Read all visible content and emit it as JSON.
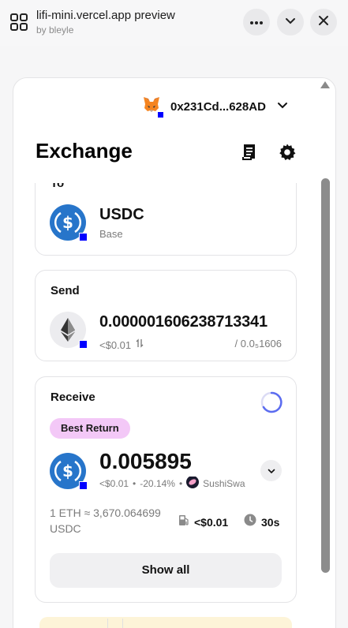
{
  "window": {
    "title": "lifi-mini.vercel.app preview",
    "subtitle": "by bleyle"
  },
  "wallet": {
    "address": "0x231Cd...628AD"
  },
  "exchange": {
    "title": "Exchange"
  },
  "to_card": {
    "label": "To",
    "token_symbol": "USDC",
    "chain_name": "Base"
  },
  "send_card": {
    "label": "Send",
    "amount": "0.000001606238713341",
    "usd_value": "<$0.01",
    "balance": "/ 0.0₅1606"
  },
  "receive_card": {
    "label": "Receive",
    "badge": "Best Return",
    "amount": "0.005895",
    "usd_value": "<$0.01",
    "price_impact": "-20.14%",
    "provider": "SushiSwa",
    "rate_line1": "1 ETH ≈ 3,670.064699",
    "rate_line2": "USDC",
    "gas_fee": "<$0.01",
    "time": "30s",
    "show_all_label": "Show all"
  },
  "colors": {
    "usdc_blue": "#2775ca",
    "chain_badge": "#0000ff",
    "best_return_pill": "#f3c8f7",
    "spinner": "#5b6cf0"
  },
  "icons": {
    "apps": "grid-icon",
    "more": "more-dots-icon",
    "collapse": "chevron-down-icon",
    "close": "close-icon",
    "history": "receipt-icon",
    "settings": "gear-icon",
    "gas": "gas-pump-icon",
    "time": "clock-icon"
  }
}
